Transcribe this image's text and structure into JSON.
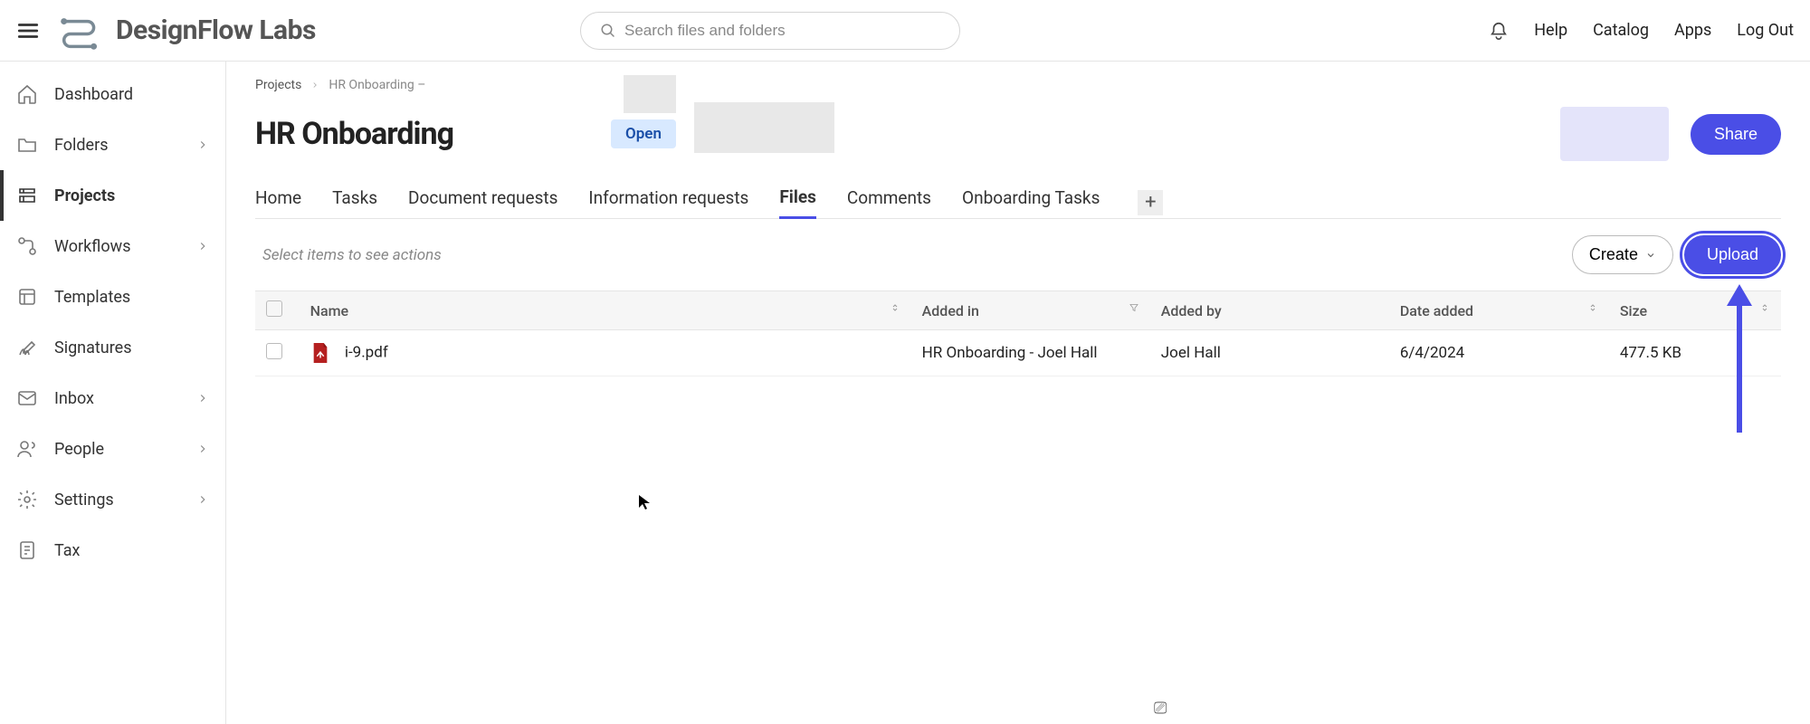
{
  "brand": {
    "name": "DesignFlow Labs"
  },
  "search": {
    "placeholder": "Search files and folders"
  },
  "topbar": {
    "links": {
      "help": "Help",
      "catalog": "Catalog",
      "apps": "Apps",
      "logout": "Log Out"
    }
  },
  "sidebar": {
    "items": [
      {
        "label": "Dashboard"
      },
      {
        "label": "Folders",
        "expandable": true
      },
      {
        "label": "Projects",
        "active": true
      },
      {
        "label": "Workflows",
        "expandable": true
      },
      {
        "label": "Templates"
      },
      {
        "label": "Signatures"
      },
      {
        "label": "Inbox",
        "expandable": true
      },
      {
        "label": "People",
        "expandable": true
      },
      {
        "label": "Settings",
        "expandable": true
      },
      {
        "label": "Tax"
      }
    ]
  },
  "breadcrumb": {
    "root": "Projects",
    "current": "HR Onboarding –"
  },
  "page": {
    "title": "HR Onboarding",
    "status": "Open"
  },
  "buttons": {
    "share": "Share",
    "create": "Create",
    "upload": "Upload"
  },
  "tabs": [
    {
      "label": "Home"
    },
    {
      "label": "Tasks"
    },
    {
      "label": "Document requests"
    },
    {
      "label": "Information requests"
    },
    {
      "label": "Files",
      "active": true
    },
    {
      "label": "Comments"
    },
    {
      "label": "Onboarding Tasks"
    }
  ],
  "actionHint": "Select items to see actions",
  "table": {
    "columns": {
      "name": "Name",
      "addedIn": "Added in",
      "addedBy": "Added by",
      "dateAdded": "Date added",
      "size": "Size"
    },
    "rows": [
      {
        "name": "i-9.pdf",
        "addedIn": "HR Onboarding - Joel Hall",
        "addedBy": "Joel Hall",
        "dateAdded": "6/4/2024",
        "size": "477.5 KB"
      }
    ]
  }
}
